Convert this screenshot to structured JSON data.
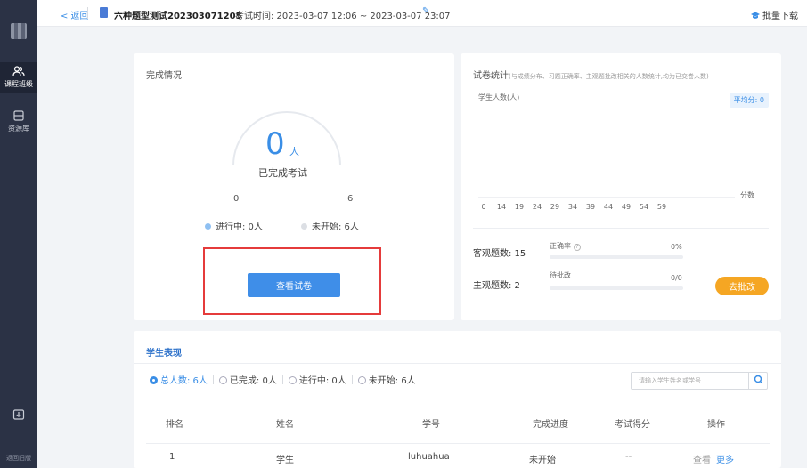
{
  "sidebar": {
    "items": [
      {
        "label": "课程班级",
        "icon": "users-icon"
      },
      {
        "label": "资源库",
        "icon": "archive-icon"
      }
    ],
    "bottom_label": "返回旧版"
  },
  "topbar": {
    "back_label": "< 返回",
    "exam_title": "六种题型测试202303071205",
    "exam_time": "考试时间: 2023-03-07 12:06 ~ 2023-03-07 23:07",
    "download_label": "批量下载"
  },
  "completion": {
    "title": "完成情况",
    "count": "0",
    "unit": "人",
    "label": "已完成考试",
    "min": "0",
    "max": "6",
    "in_progress": "进行中: 0人",
    "not_started": "未开始: 6人",
    "view_button": "查看试卷"
  },
  "stats": {
    "title": "试卷统计",
    "subtitle": "(与成绩分布、习题正确率、主观题批改相关的人数统计,均为已交卷人数)",
    "y_label": "学生人数(人)",
    "avg_label": "平均分: 0",
    "x_unit": "分数",
    "objective_label": "客观题数: 15",
    "accuracy_label": "正确率",
    "accuracy_value": "0%",
    "subjective_label": "主观题数: 2",
    "pending_label": "待批改",
    "pending_value": "0/0",
    "grade_button": "去批改"
  },
  "chart_data": {
    "type": "bar",
    "categories": [
      "0",
      "14",
      "19",
      "24",
      "29",
      "34",
      "39",
      "44",
      "49",
      "54",
      "59"
    ],
    "values": [
      0,
      0,
      0,
      0,
      0,
      0,
      0,
      0,
      0,
      0,
      0
    ],
    "ylabel": "学生人数(人)",
    "xlabel": "分数"
  },
  "students": {
    "title": "学生表现",
    "filters": [
      "总人数: 6人",
      "已完成: 0人",
      "进行中: 0人",
      "未开始: 6人"
    ],
    "search_placeholder": "请输入学生姓名或学号",
    "columns": [
      "排名",
      "姓名",
      "学号",
      "完成进度",
      "考试得分",
      "操作"
    ],
    "rows": [
      {
        "rank": "1",
        "name": "学生",
        "id": "luhuahua",
        "progress": "未开始",
        "score": "--",
        "view": "查看",
        "more": "更多"
      }
    ]
  },
  "colors": {
    "accent": "#3a8ee6",
    "warning": "#f5a623",
    "sidebar": "#2b3245",
    "highlight": "#e53b3b"
  }
}
